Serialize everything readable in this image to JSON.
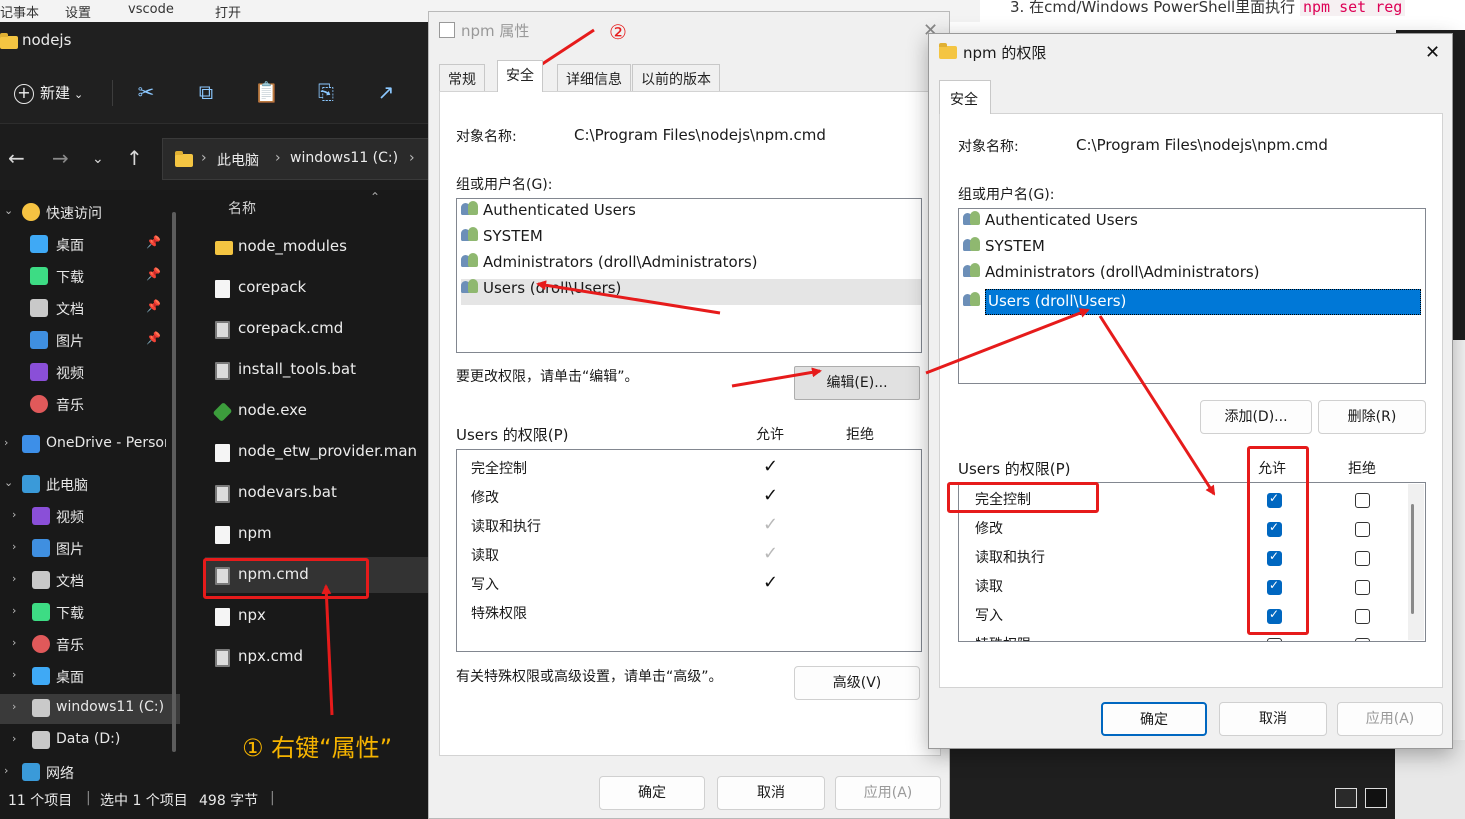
{
  "background": {
    "top_menu": [
      "记事本",
      "设置",
      "vscode",
      "打开"
    ],
    "doc_heading": "3. 在cmd/Windows PowerShell里面执行",
    "doc_code": "npm set reg"
  },
  "explorer": {
    "title": "nodejs",
    "toolbar": {
      "new_label": "新建"
    },
    "breadcrumb": [
      "此电脑",
      "windows11 (C:)"
    ],
    "nav_items": [
      {
        "label": "快速访问",
        "icon": "star-icon",
        "color": "#f6c342"
      },
      {
        "label": "桌面",
        "icon": "desktop-icon",
        "color": "#3fa9f5",
        "pinned": true
      },
      {
        "label": "下载",
        "icon": "download-icon",
        "color": "#3ddc84",
        "pinned": true
      },
      {
        "label": "文档",
        "icon": "document-icon",
        "color": "#c9c9c9",
        "pinned": true
      },
      {
        "label": "图片",
        "icon": "picture-icon",
        "color": "#3f8fe0",
        "pinned": true
      },
      {
        "label": "视频",
        "icon": "video-icon",
        "color": "#8a4fd8"
      },
      {
        "label": "音乐",
        "icon": "music-icon",
        "color": "#e0595a"
      },
      {
        "label": "OneDrive - Personal",
        "icon": "onedrive-icon",
        "color": "#3d8fe8"
      },
      {
        "label": "此电脑",
        "icon": "this-pc-icon",
        "color": "#3a9ad9"
      },
      {
        "label": "视频",
        "icon": "video-icon",
        "color": "#8a4fd8"
      },
      {
        "label": "图片",
        "icon": "picture-icon",
        "color": "#3f8fe0"
      },
      {
        "label": "文档",
        "icon": "document-icon",
        "color": "#c9c9c9"
      },
      {
        "label": "下载",
        "icon": "download-icon",
        "color": "#3ddc84"
      },
      {
        "label": "音乐",
        "icon": "music-icon",
        "color": "#e0595a"
      },
      {
        "label": "桌面",
        "icon": "desktop-icon",
        "color": "#3fa9f5"
      },
      {
        "label": "windows11 (C:)",
        "icon": "drive-icon",
        "color": "#c9c9c9"
      },
      {
        "label": "Data (D:)",
        "icon": "drive-icon",
        "color": "#c9c9c9"
      },
      {
        "label": "网络",
        "icon": "network-icon",
        "color": "#3a9ad9"
      }
    ],
    "column_header": "名称",
    "files": [
      {
        "name": "node_modules",
        "type": "folder"
      },
      {
        "name": "corepack",
        "type": "file"
      },
      {
        "name": "corepack.cmd",
        "type": "cmd"
      },
      {
        "name": "install_tools.bat",
        "type": "cmd"
      },
      {
        "name": "node.exe",
        "type": "node"
      },
      {
        "name": "node_etw_provider.man",
        "type": "file"
      },
      {
        "name": "nodevars.bat",
        "type": "cmd"
      },
      {
        "name": "npm",
        "type": "file"
      },
      {
        "name": "npm.cmd",
        "type": "cmd",
        "selected": true
      },
      {
        "name": "npx",
        "type": "file"
      },
      {
        "name": "npx.cmd",
        "type": "cmd"
      }
    ],
    "status": {
      "count": "11 个项目",
      "selected": "选中 1 个项目",
      "size": "498 字节"
    },
    "annotation": "① 右键“属性”"
  },
  "properties": {
    "title": "npm 属性",
    "tabs": [
      "常规",
      "安全",
      "详细信息",
      "以前的版本"
    ],
    "active_tab": "安全",
    "annotation": "②",
    "object_label": "对象名称:",
    "object_value": "C:\\Program Files\\nodejs\\npm.cmd",
    "groups_label": "组或用户名(G):",
    "groups": [
      "Authenticated Users",
      "SYSTEM",
      "Administrators (droll\\Administrators)",
      "Users (droll\\Users)"
    ],
    "change_hint": "要更改权限，请单击“编辑”。",
    "edit_button": "编辑(E)...",
    "perm_label": "Users 的权限(P)",
    "allow_label": "允许",
    "deny_label": "拒绝",
    "permissions": [
      {
        "name": "完全控制",
        "allow": "✓",
        "state": "on"
      },
      {
        "name": "修改",
        "allow": "✓",
        "state": "on"
      },
      {
        "name": "读取和执行",
        "allow": "✓",
        "state": "inherited"
      },
      {
        "name": "读取",
        "allow": "✓",
        "state": "inherited"
      },
      {
        "name": "写入",
        "allow": "✓",
        "state": "on"
      },
      {
        "name": "特殊权限",
        "allow": "",
        "state": "none"
      }
    ],
    "advanced_hint": "有关特殊权限或高级设置，请单击“高级”。",
    "advanced_button": "高级(V)",
    "ok": "确定",
    "cancel": "取消",
    "apply": "应用(A)"
  },
  "permissions_dialog": {
    "title": "npm 的权限",
    "tab": "安全",
    "object_label": "对象名称:",
    "object_value": "C:\\Program Files\\nodejs\\npm.cmd",
    "groups_label": "组或用户名(G):",
    "groups": [
      "Authenticated Users",
      "SYSTEM",
      "Administrators (droll\\Administrators)",
      "Users (droll\\Users)"
    ],
    "add_button": "添加(D)...",
    "remove_button": "删除(R)",
    "perm_label": "Users 的权限(P)",
    "allow_label": "允许",
    "deny_label": "拒绝",
    "permissions": [
      {
        "name": "完全控制",
        "allow": true,
        "deny": false
      },
      {
        "name": "修改",
        "allow": true,
        "deny": false
      },
      {
        "name": "读取和执行",
        "allow": true,
        "deny": false
      },
      {
        "name": "读取",
        "allow": true,
        "deny": false
      },
      {
        "name": "写入",
        "allow": true,
        "deny": false
      },
      {
        "name": "特殊权限",
        "allow": false,
        "deny": false
      }
    ],
    "ok": "确定",
    "cancel": "取消",
    "apply": "应用(A)"
  }
}
